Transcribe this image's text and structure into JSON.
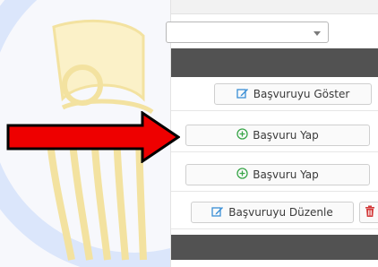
{
  "buttons": {
    "show_application": "Başvuruyu Göster",
    "apply_1": "Başvuru Yap",
    "apply_2": "Başvuru Yap",
    "edit_application": "Başvuruyu Düzenle"
  },
  "icons": {
    "show": "edit-icon",
    "apply": "plus-circle-icon",
    "edit": "edit-icon",
    "delete": "trash-icon"
  },
  "colors": {
    "icon_blue": "#3a8fd6",
    "icon_green": "#3aa64a",
    "icon_red": "#d33b3b",
    "arrow_red": "#ee0000",
    "dark_bar": "#525252",
    "watermark": "#dbe6fb",
    "watermark_yellow": "#f6e7a6"
  },
  "select": {
    "value": ""
  }
}
